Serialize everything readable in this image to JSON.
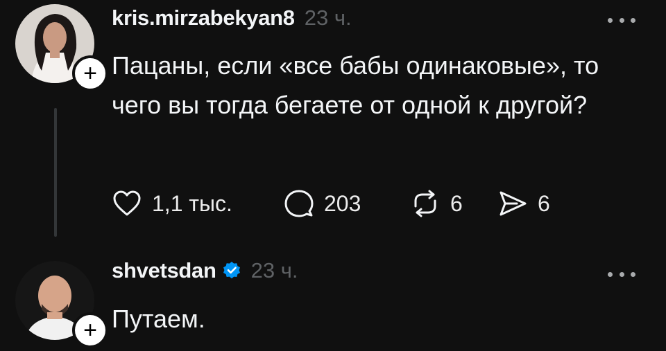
{
  "posts": [
    {
      "username": "kris.mirzabekyan8",
      "time": "23 ч.",
      "text": "Пацаны, если «все бабы одинаковые», то чего вы тогда бегаете от одной к другой?",
      "likes": "1,1 тыс.",
      "replies": "203",
      "reposts": "6",
      "shares": "6",
      "avatar_icon": "user-avatar-photo"
    },
    {
      "username": "shvetsdan",
      "verified": true,
      "time": "23 ч.",
      "text": "Путаем.",
      "avatar_icon": "user-avatar-photo"
    }
  ],
  "icons": {
    "follow": "plus-icon",
    "more": "more-dots-icon",
    "like": "heart-icon",
    "reply": "speech-bubble-icon",
    "repost": "repost-icon",
    "share": "send-icon",
    "verified": "verified-badge-icon"
  },
  "colors": {
    "background": "#101010",
    "text": "#f3f5f7",
    "muted": "#5f6265",
    "verified": "#0095f6"
  }
}
